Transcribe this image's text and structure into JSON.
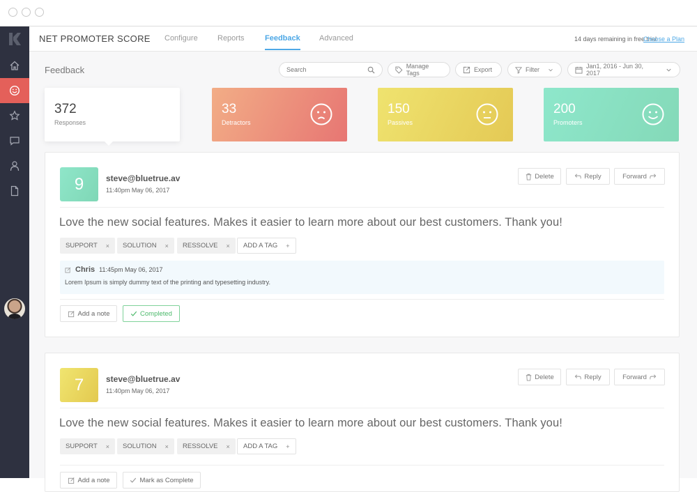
{
  "app": {
    "title": "NET PROMOTER SCORE",
    "tabs": [
      {
        "label": "Configure",
        "active": false
      },
      {
        "label": "Reports",
        "active": false
      },
      {
        "label": "Feedback",
        "active": true
      },
      {
        "label": "Advanced",
        "active": false
      }
    ],
    "trial_text": "14 days remaining in free trial",
    "plan_link": "Choose a Plan"
  },
  "sidebar": {
    "items": [
      {
        "icon": "home-icon",
        "active": false
      },
      {
        "icon": "smiley-icon",
        "active": true
      },
      {
        "icon": "star-icon",
        "active": false
      },
      {
        "icon": "chat-icon",
        "active": false
      },
      {
        "icon": "user-icon",
        "active": false
      },
      {
        "icon": "document-icon",
        "active": false
      }
    ],
    "accent": "#e4605a"
  },
  "toolbar": {
    "page_title": "Feedback",
    "search_placeholder": "Search",
    "manage_tags": "Manage Tags",
    "export": "Export",
    "filter": "Filter",
    "date_range": "Jan1, 2016 - Jun 30, 2017"
  },
  "stats": [
    {
      "value": "372",
      "label": "Responses"
    },
    {
      "value": "33",
      "label": "Detractors",
      "face": "sad"
    },
    {
      "value": "150",
      "label": "Passives",
      "face": "neutral"
    },
    {
      "value": "200",
      "label": "Promoters",
      "face": "happy"
    }
  ],
  "feedback": [
    {
      "score": "9",
      "score_color": "#86dcbf",
      "email": "steve@bluetrue.av",
      "time": "11:40pm  May 06, 2017",
      "message": "Love the new social features. Makes it easier to learn more about our best customers. Thank you!",
      "tags": [
        "SUPPORT",
        "SOLUTION",
        "RESSOLVE"
      ],
      "add_tag": "ADD A TAG",
      "note": {
        "author": "Chris",
        "time": "11:45pm  May 06, 2017",
        "text": "Lorem Ipsum is simply dummy text of the printing and typesetting industry."
      },
      "add_note": "Add a note",
      "status": "Completed"
    },
    {
      "score": "7",
      "score_color": "#e8d45a",
      "email": "steve@bluetrue.av",
      "time": "11:40pm  May 06, 2017",
      "message": "Love the new social features. Makes it easier to learn more about our best customers. Thank you!",
      "tags": [
        "SUPPORT",
        "SOLUTION",
        "RESSOLVE"
      ],
      "add_tag": "ADD A TAG",
      "add_note": "Add a note",
      "status": "Mark as Complete"
    }
  ],
  "actions": {
    "delete": "Delete",
    "reply": "Reply",
    "forward": "Forward"
  }
}
